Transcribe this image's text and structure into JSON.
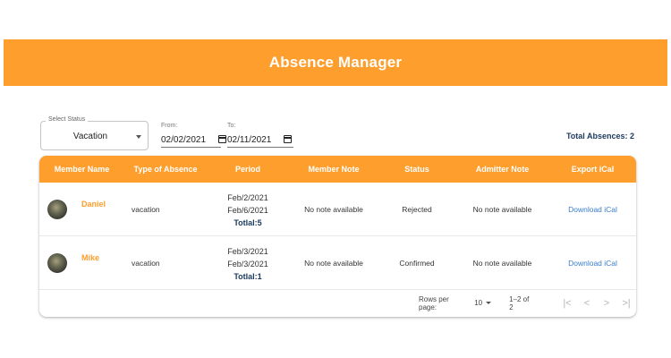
{
  "app": {
    "title": "Absence Manager"
  },
  "filters": {
    "status_label": "Select Status",
    "status_value": "Vacation",
    "from_label": "From:",
    "from_value": "02/02/2021",
    "to_label": "To:",
    "to_value": "02/11/2021",
    "total_label": "Total Absences: 2"
  },
  "table": {
    "headers": [
      "Member Name",
      "Type of Absence",
      "Period",
      "Member Note",
      "Status",
      "Admitter Note",
      "Export iCal"
    ],
    "rows": [
      {
        "name": "Daniel",
        "type": "vacation",
        "period_start": "Feb/2/2021",
        "period_end": "Feb/6/2021",
        "total": "Totlal:5",
        "member_note": "No note available",
        "status": "Rejected",
        "admitter_note": "No note available",
        "export": "Download iCal"
      },
      {
        "name": "Mike",
        "type": "vacation",
        "period_start": "Feb/3/2021",
        "period_end": "Feb/3/2021",
        "total": "Totlal:1",
        "member_note": "No note available",
        "status": "Confirmed",
        "admitter_note": "No note available",
        "export": "Download iCal"
      }
    ]
  },
  "pagination": {
    "rows_per_page_label": "Rows per page:",
    "rows_per_page_value": "10",
    "range": "1–2 of 2"
  },
  "icons": {
    "status_dropdown": "caret-down-icon",
    "date_picker": "calendar-icon",
    "first_page": "first-page-icon",
    "prev_page": "chevron-left-icon",
    "next_page": "chevron-right-icon",
    "last_page": "last-page-icon"
  },
  "colors": {
    "accent": "#FD9E2D",
    "link": "#3a7dc9",
    "navy": "#1a3a5c"
  }
}
